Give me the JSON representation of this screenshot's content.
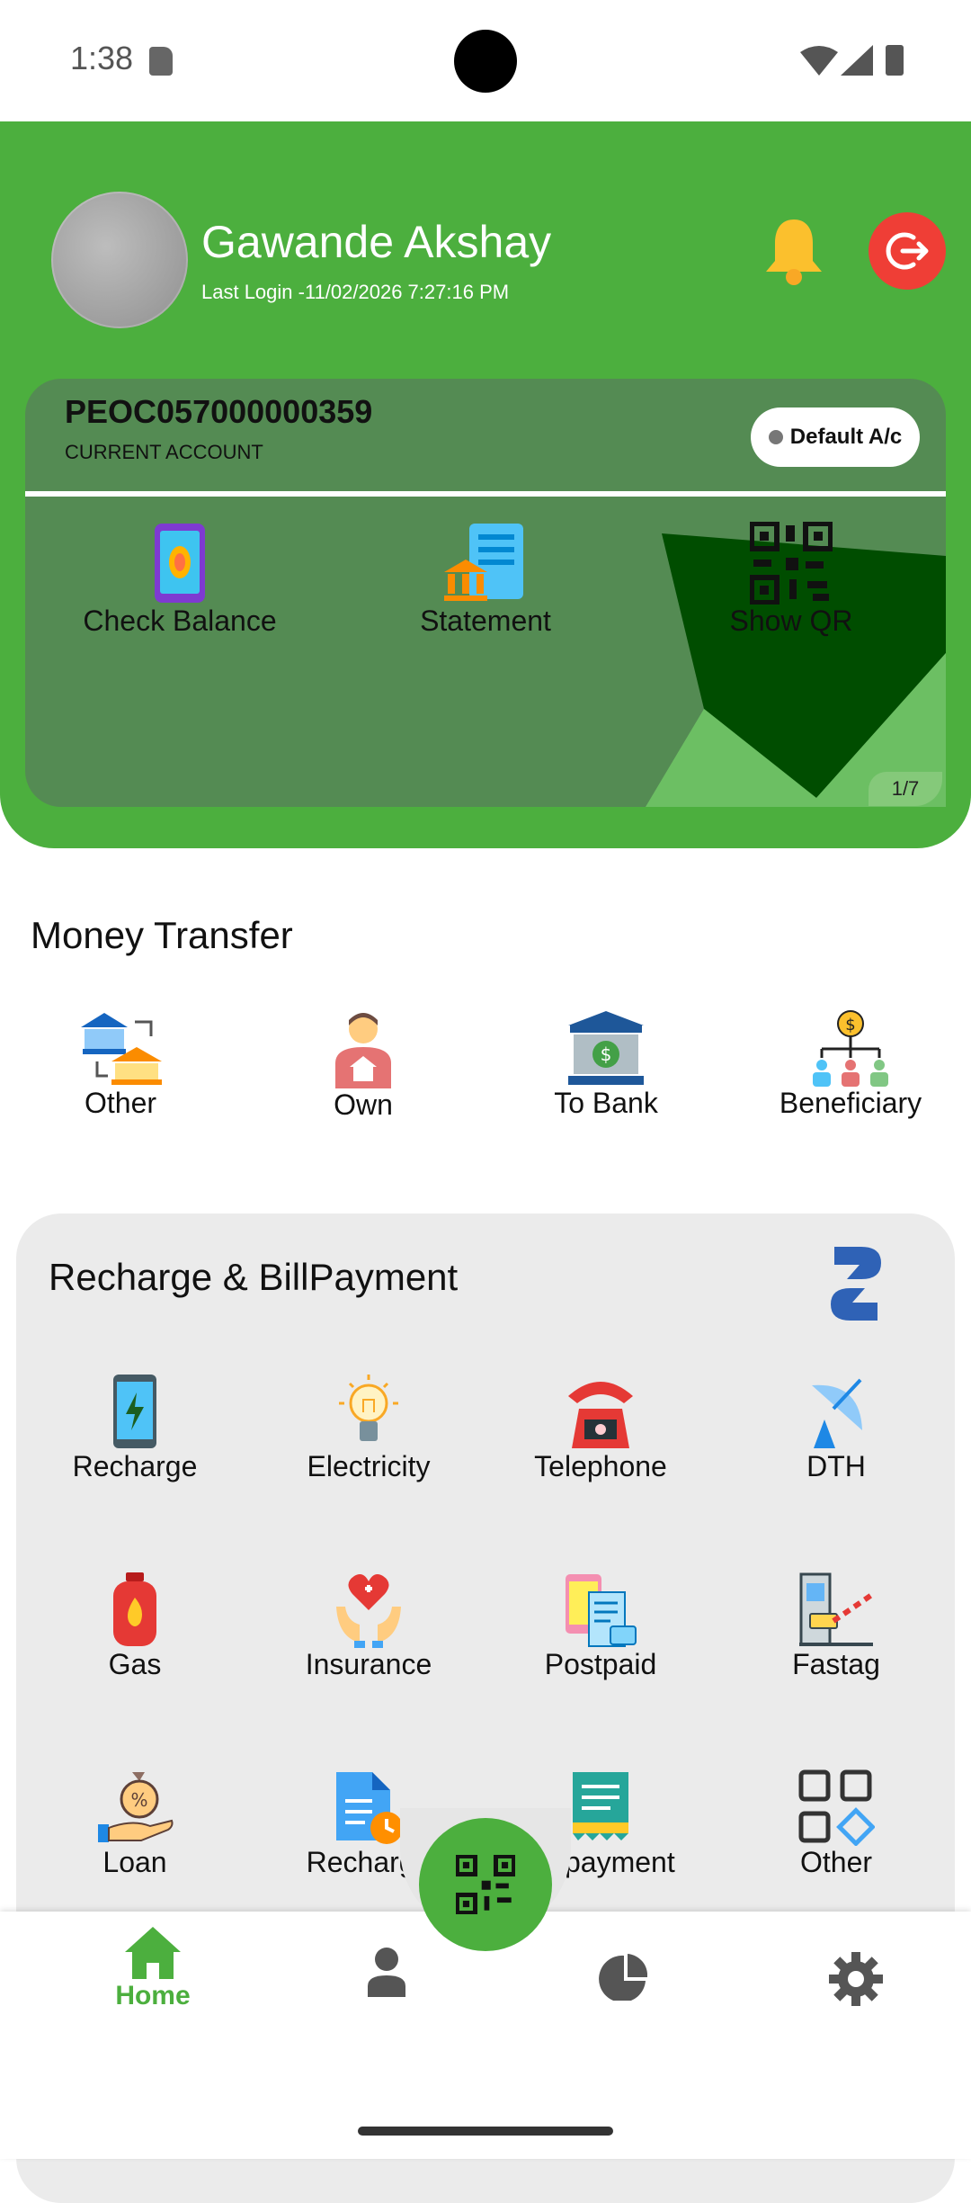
{
  "status_bar": {
    "time": "1:38"
  },
  "header": {
    "user_name": "Gawande Akshay",
    "last_login": "Last Login -11/02/2026 7:27:16 PM"
  },
  "account": {
    "number": "PEOC057000000359",
    "type": "CURRENT ACCOUNT",
    "default_label": "Default A/c",
    "page_indicator": "1/7",
    "actions": [
      {
        "label": "Check Balance"
      },
      {
        "label": "Statement"
      },
      {
        "label": "Show QR"
      }
    ]
  },
  "money_transfer": {
    "title": "Money Transfer",
    "items": [
      {
        "label": "Other"
      },
      {
        "label": "Own"
      },
      {
        "label": "To Bank"
      },
      {
        "label": "Beneficiary"
      }
    ]
  },
  "recharge_bill": {
    "title": "Recharge & BillPayment",
    "items": [
      {
        "label": "Recharge"
      },
      {
        "label": "Electricity"
      },
      {
        "label": "Telephone"
      },
      {
        "label": "DTH"
      },
      {
        "label": "Gas"
      },
      {
        "label": "Insurance"
      },
      {
        "label": "Postpaid"
      },
      {
        "label": "Fastag"
      },
      {
        "label": "Loan"
      },
      {
        "label": "Recharge"
      },
      {
        "label": "Billpayment"
      },
      {
        "label": "Other"
      }
    ]
  },
  "bottom_nav": {
    "home_label": "Home"
  },
  "colors": {
    "brand_green": "#4caf3e",
    "card_green": "#548b53",
    "logout_red": "#ef3e36",
    "bell_yellow": "#fbc02d"
  }
}
